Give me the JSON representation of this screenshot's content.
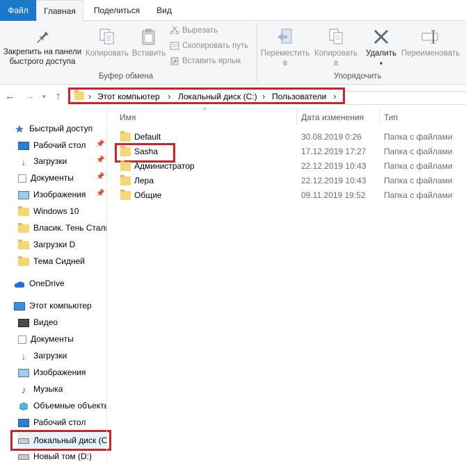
{
  "tabs": {
    "file": "Файл",
    "home": "Главная",
    "share": "Поделиться",
    "view": "Вид"
  },
  "ribbon": {
    "pin_line1": "Закрепить на панели",
    "pin_line2": "быстрого доступа",
    "copy": "Копировать",
    "paste": "Вставить",
    "cut": "Вырезать",
    "copy_path": "Скопировать путь",
    "paste_shortcut": "Вставить ярлык",
    "clipboard_group": "Буфер обмена",
    "move_line1": "Переместить",
    "move_line2": "в",
    "copyto_line1": "Копировать",
    "copyto_line2": "в",
    "delete": "Удалить",
    "rename": "Переименовать",
    "organize_group": "Упорядочить"
  },
  "address": {
    "seg1": "Этот компьютер",
    "seg2": "Локальный диск (C:)",
    "seg3": "Пользователи"
  },
  "navpane": {
    "quick_access": "Быстрый доступ",
    "desktop": "Рабочий стол",
    "downloads": "Загрузки",
    "documents": "Документы",
    "pictures": "Изображения",
    "win10": "Windows 10",
    "vlasik": "Власик. Тень Стали",
    "downloads_d": "Загрузки D",
    "tema": "Тема Сидней",
    "onedrive": "OneDrive",
    "this_pc": "Этот компьютер",
    "video": "Видео",
    "pc_documents": "Документы",
    "pc_downloads": "Загрузки",
    "pc_pictures": "Изображения",
    "music": "Музыка",
    "objects3d": "Объемные объекты",
    "pc_desktop": "Рабочий стол",
    "local_disk": "Локальный диск (C:)",
    "new_volume": "Новый том (D:)"
  },
  "columns": {
    "name": "Имя",
    "date": "Дата изменения",
    "type": "Тип"
  },
  "files": [
    {
      "name": "Default",
      "date": "30.08.2019 0:26",
      "type": "Папка с файлами"
    },
    {
      "name": "Sasha",
      "date": "17.12.2019 17:27",
      "type": "Папка с файлами"
    },
    {
      "name": "Администратор",
      "date": "22.12.2019 10:43",
      "type": "Папка с файлами"
    },
    {
      "name": "Лера",
      "date": "22.12.2019 10:43",
      "type": "Папка с файлами"
    },
    {
      "name": "Общие",
      "date": "09.11.2019 19:52",
      "type": "Папка с файлами"
    }
  ],
  "colors": {
    "file_tab": "#1979ca",
    "highlight_red": "#d4202b",
    "folder_yellow": "#f8d675"
  }
}
